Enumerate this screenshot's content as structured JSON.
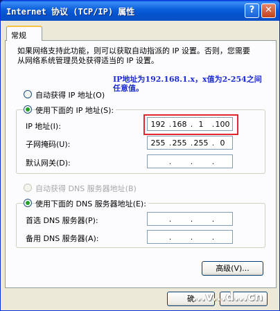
{
  "window": {
    "title": "Internet 协议 (TCP/IP) 属性",
    "help_label": "?",
    "close_label": "✕"
  },
  "tabs": [
    {
      "label": "常规"
    }
  ],
  "description": "如果网络支持此功能，则可以获取自动指派的 IP 设置。否则，您需要从网络系统管理员处获得适当的 IP 设置。",
  "annotation": "IP地址为192.168.1.x，x值为2-254之间任意值。",
  "ip_mode": {
    "auto_label": "自动获得 IP 地址(O)",
    "auto_selected": false,
    "manual_label": "使用下面的 IP 地址(S):",
    "manual_selected": true
  },
  "ip_fields": {
    "ip": {
      "label": "IP 地址(I):",
      "octets": [
        "192",
        "168",
        "1",
        "100"
      ]
    },
    "subnet": {
      "label": "子网掩码(U):",
      "octets": [
        "255",
        "255",
        "255",
        "0"
      ]
    },
    "gateway": {
      "label": "默认网关(D):",
      "octets": [
        "",
        "",
        "",
        ""
      ]
    }
  },
  "dns_mode": {
    "auto_label": "自动获得 DNS 服务器地址(B)",
    "auto_selected": false,
    "auto_disabled": true,
    "manual_label": "使用下面的 DNS 服务器地址(E):",
    "manual_selected": true
  },
  "dns_fields": {
    "preferred": {
      "label": "首选 DNS 服务器(P):",
      "octets": [
        "",
        "",
        "",
        ""
      ]
    },
    "alternate": {
      "label": "备用 DNS 服务器(A):",
      "octets": [
        "",
        "",
        "",
        ""
      ]
    }
  },
  "buttons": {
    "advanced": "高级(V)...",
    "ok": "确",
    "cancel": ""
  },
  "watermark": "...v...d...cn"
}
